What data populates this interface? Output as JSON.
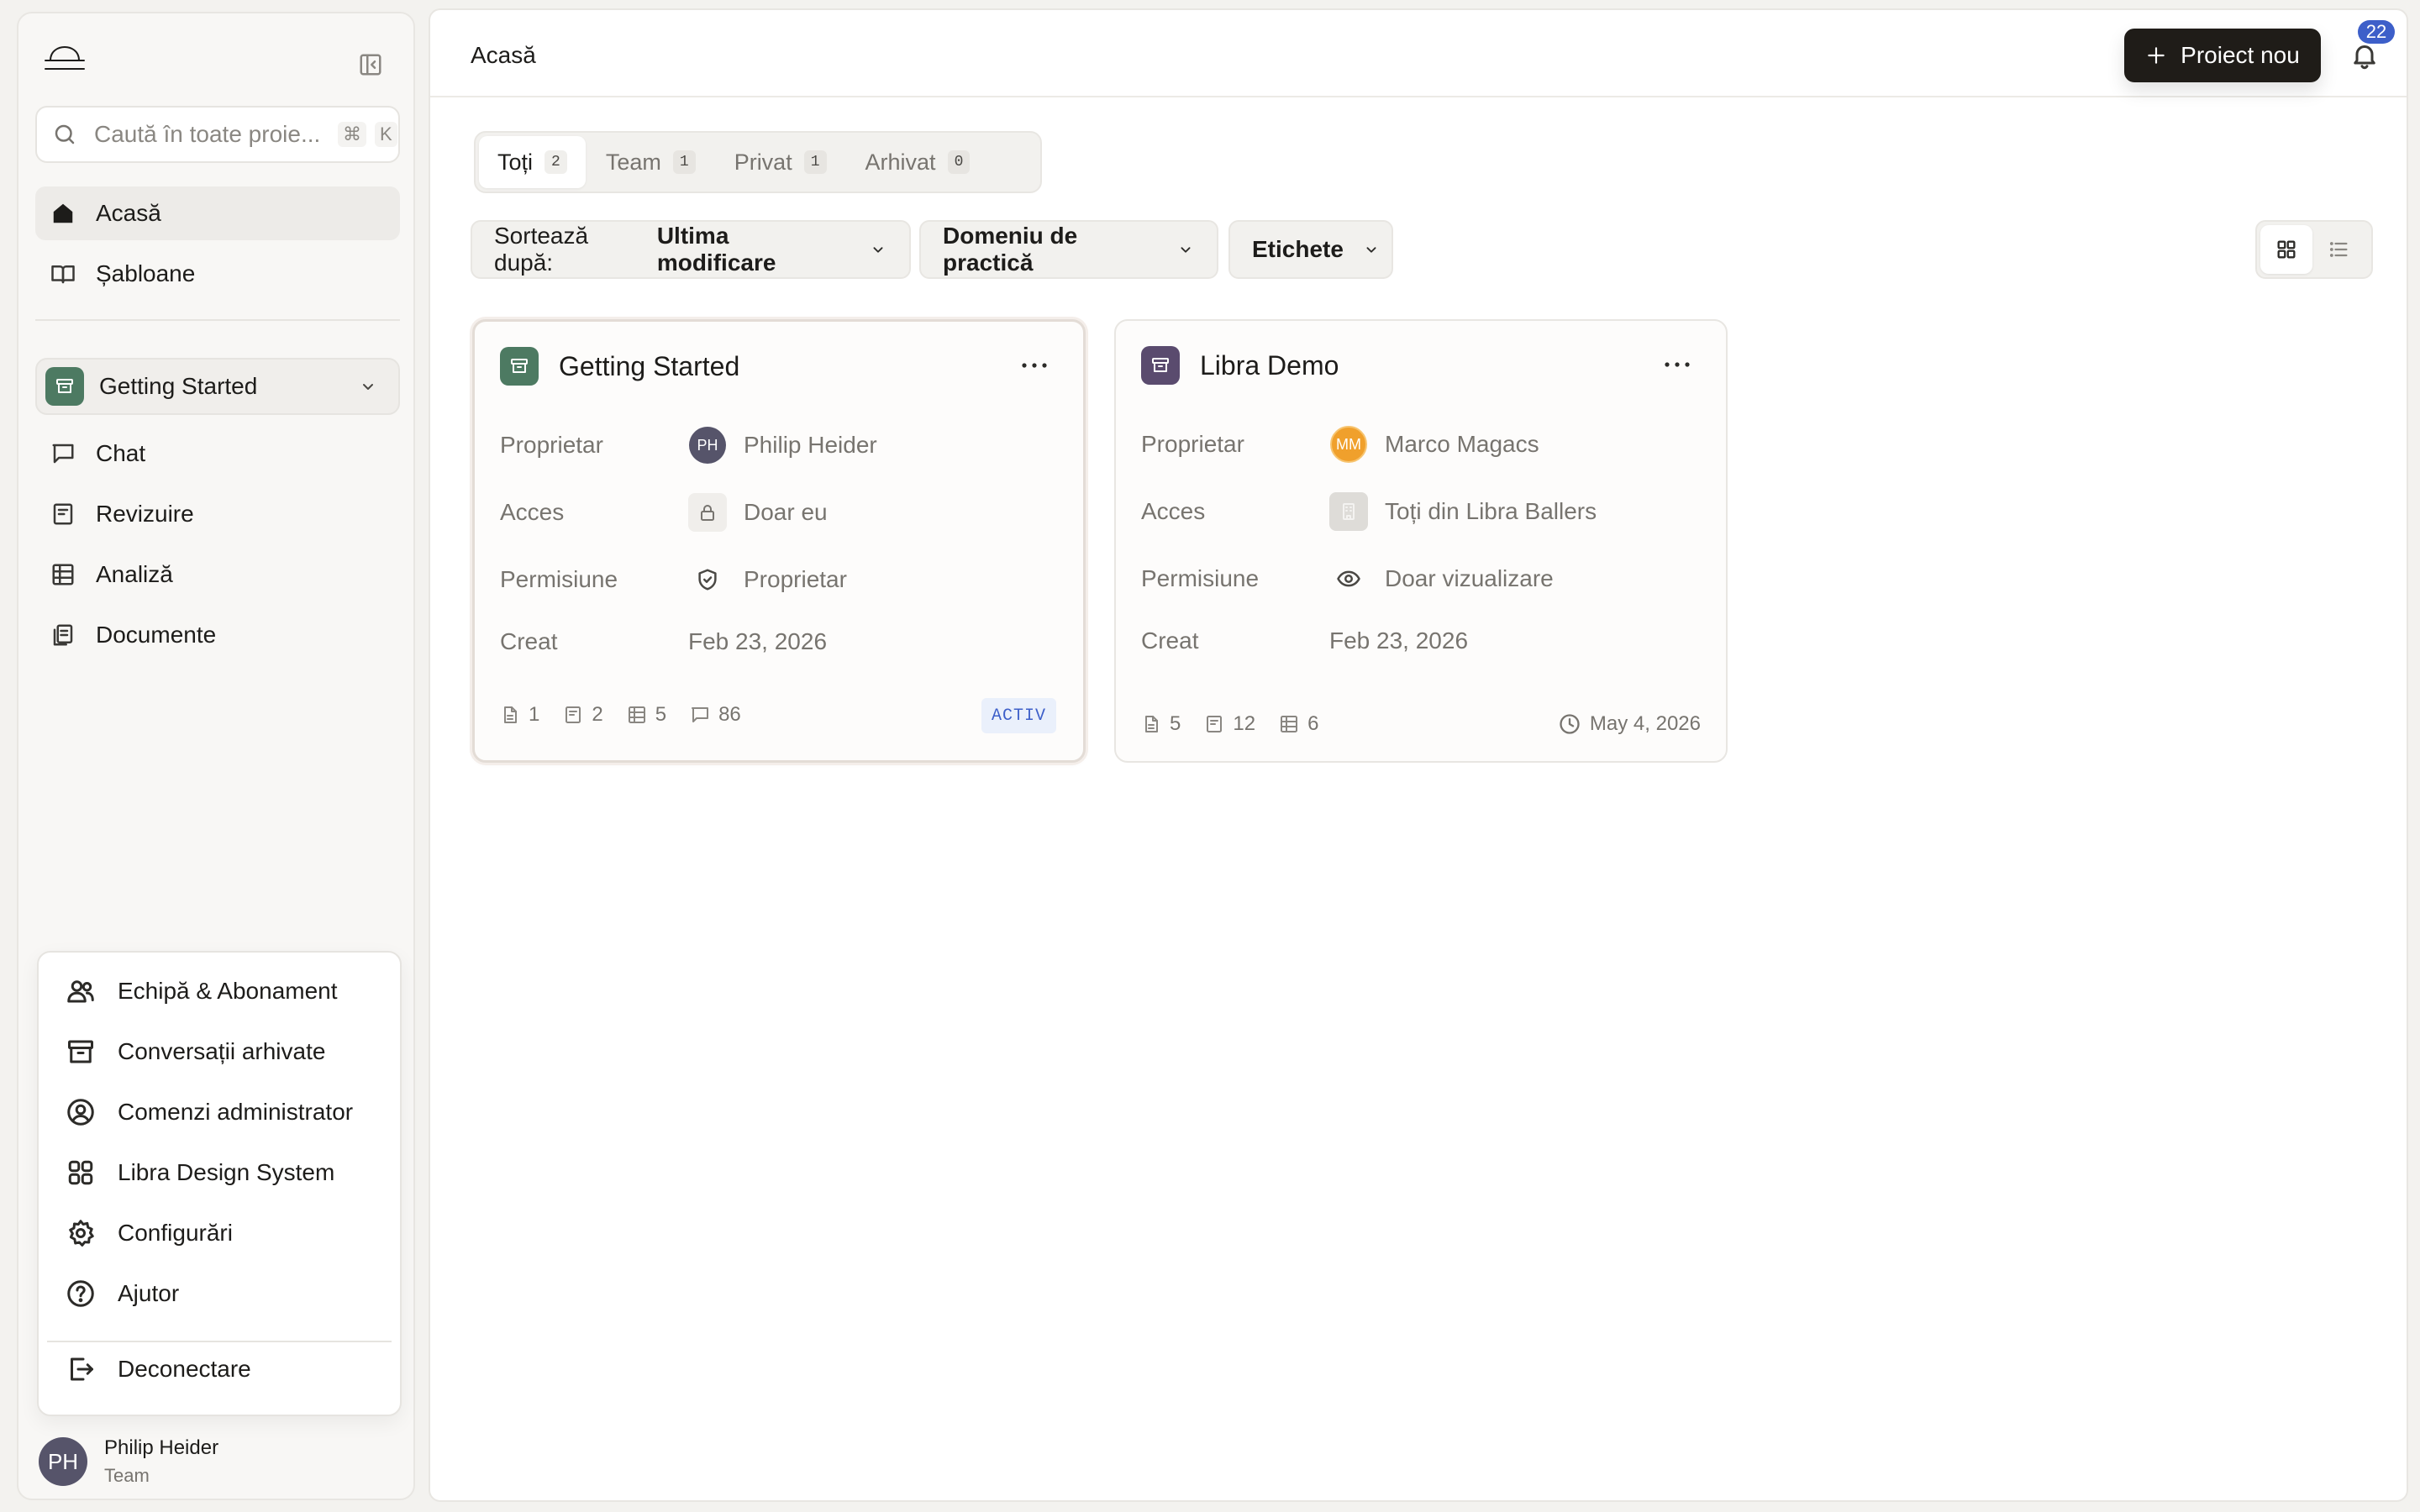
{
  "sidebar": {
    "search": {
      "placeholder": "Caută în toate proie...",
      "shortcut_mod": "⌘",
      "shortcut_key": "K"
    },
    "nav": [
      {
        "label": "Acasă",
        "icon": "home-icon",
        "active": true
      },
      {
        "label": "Șabloane",
        "icon": "book-icon",
        "active": false
      }
    ],
    "project_selector": {
      "label": "Getting Started",
      "color": "#4d7a62"
    },
    "project_nav": [
      {
        "label": "Chat",
        "icon": "chat-icon"
      },
      {
        "label": "Revizuire",
        "icon": "review-icon"
      },
      {
        "label": "Analiză",
        "icon": "table-icon"
      },
      {
        "label": "Documente",
        "icon": "documents-icon"
      }
    ],
    "menu": [
      {
        "label": "Echipă & Abonament",
        "icon": "users-icon"
      },
      {
        "label": "Conversații arhivate",
        "icon": "archive-icon"
      },
      {
        "label": "Comenzi administrator",
        "icon": "user-circle-icon"
      },
      {
        "label": "Libra Design System",
        "icon": "grid-icon"
      },
      {
        "label": "Configurări",
        "icon": "gear-icon"
      },
      {
        "label": "Ajutor",
        "icon": "help-icon"
      },
      {
        "label": "Deconectare",
        "icon": "logout-icon"
      }
    ],
    "user": {
      "initials": "PH",
      "name": "Philip Heider",
      "plan": "Team"
    }
  },
  "header": {
    "title": "Acasă",
    "new_project_label": "Proiect nou",
    "notifications_count": "22"
  },
  "tabs": [
    {
      "label": "Toți",
      "count": "2",
      "active": true
    },
    {
      "label": "Team",
      "count": "1",
      "active": false
    },
    {
      "label": "Privat",
      "count": "1",
      "active": false
    },
    {
      "label": "Arhivat",
      "count": "0",
      "active": false
    }
  ],
  "filters": {
    "sort_prefix": "Sortează după:",
    "sort_value": "Ultima modificare",
    "practice_area": "Domeniu de practică",
    "tags": "Etichete"
  },
  "view_mode": "grid",
  "cards": [
    {
      "title": "Getting Started",
      "color": "#4d7a62",
      "owner_label": "Proprietar",
      "owner_initials": "PH",
      "owner_name": "Philip Heider",
      "owner_avatar_color": "#56546a",
      "access_label": "Acces",
      "access_value": "Doar eu",
      "permission_label": "Permisiune",
      "permission_value": "Proprietar",
      "created_label": "Creat",
      "created_value": "Feb 23, 2026",
      "stats": {
        "documents": "1",
        "reviews": "2",
        "tables": "5",
        "chats": "86"
      },
      "status": "ACTIV"
    },
    {
      "title": "Libra Demo",
      "color": "#5a4b6e",
      "owner_label": "Proprietar",
      "owner_initials": "MM",
      "owner_name": "Marco Magacs",
      "owner_avatar_color": "#f0a02c",
      "access_label": "Acces",
      "access_value": "Toți din Libra Ballers",
      "permission_label": "Permisiune",
      "permission_value": "Doar vizualizare",
      "created_label": "Creat",
      "created_value": "Feb 23, 2026",
      "stats": {
        "documents": "5",
        "reviews": "12",
        "tables": "6"
      },
      "date": "May 4, 2026"
    }
  ]
}
